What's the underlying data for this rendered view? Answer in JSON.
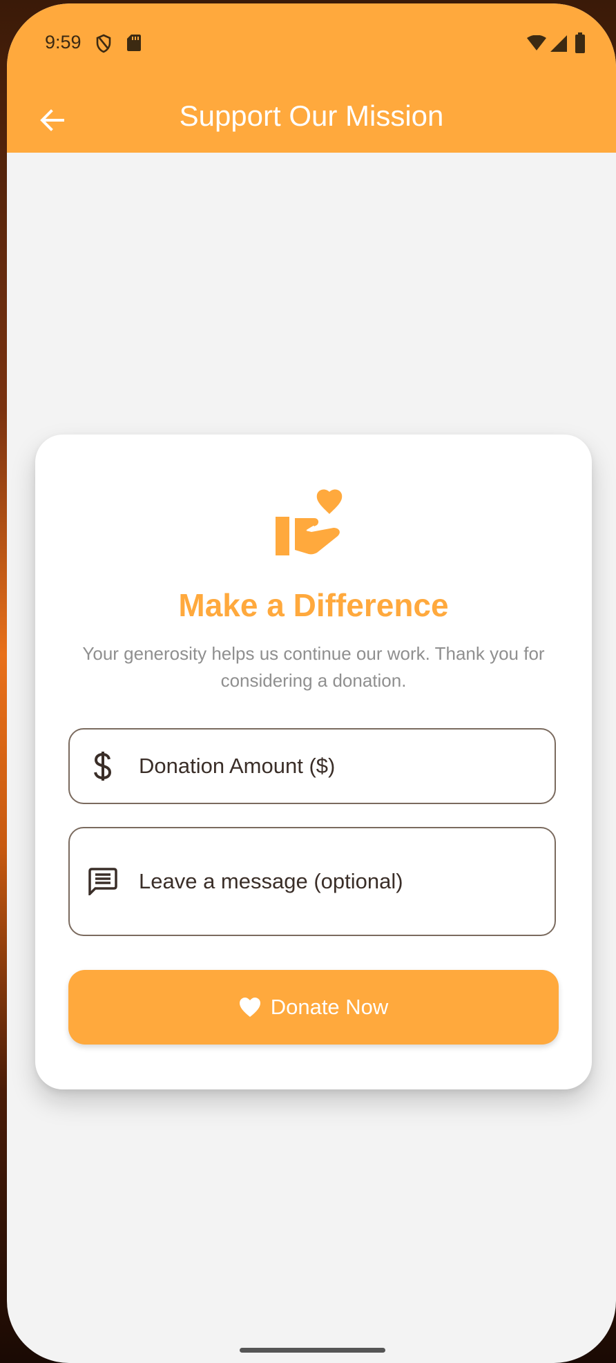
{
  "status_bar": {
    "time": "9:59",
    "icons": [
      "shield-icon",
      "sd-card-icon",
      "wifi-icon",
      "cellular-signal-icon",
      "battery-icon"
    ]
  },
  "app_bar": {
    "back_icon": "arrow-back-icon",
    "title": "Support Our Mission"
  },
  "card": {
    "icon": "volunteer-hand-heart-icon",
    "heading": "Make a Difference",
    "subtext": "Your generosity helps us continue our work. Thank you for considering a donation.",
    "amount_field": {
      "icon": "dollar-icon",
      "placeholder": "Donation Amount ($)",
      "value": ""
    },
    "message_field": {
      "icon": "message-icon",
      "placeholder": "Leave a message (optional)",
      "value": ""
    },
    "donate_button": {
      "icon": "heart-icon",
      "label": "Donate Now"
    }
  },
  "colors": {
    "accent": "#ffa93d",
    "background": "#f3f3f3",
    "card": "#ffffff",
    "subtext": "#8f8f8f",
    "field_border": "#7a6a5e"
  }
}
